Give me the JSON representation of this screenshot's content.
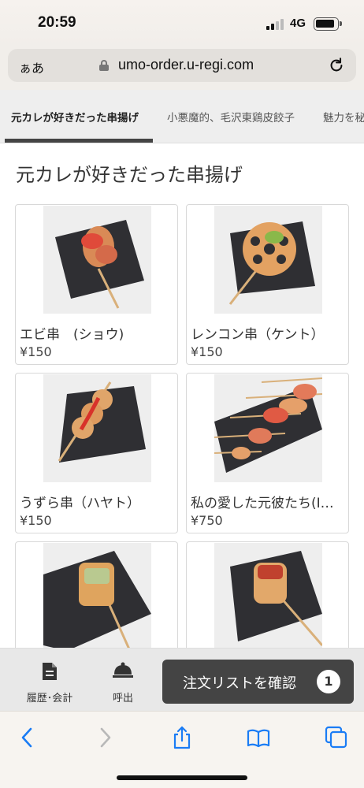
{
  "status": {
    "time": "20:59",
    "network": "4G"
  },
  "browser": {
    "aa_label": "ぁあ",
    "url": "umo-order.u-regi.com"
  },
  "tabs": [
    {
      "label": "元カレが好きだった串揚げ",
      "active": true
    },
    {
      "label": "小悪魔的、毛沢東鶏皮餃子",
      "active": false
    },
    {
      "label": "魅力を秘めた",
      "active": false
    }
  ],
  "section": {
    "title": "元カレが好きだった串揚げ"
  },
  "items": [
    {
      "name": "エビ串　(ショウ)",
      "price": "¥150"
    },
    {
      "name": "レンコン串（ケント）",
      "price": "¥150"
    },
    {
      "name": "うずら串（ハヤト）",
      "price": "¥150"
    },
    {
      "name": "私の愛した元彼たち(I…",
      "price": "¥750"
    },
    {
      "name": "",
      "price": ""
    },
    {
      "name": "",
      "price": ""
    }
  ],
  "app_bar": {
    "history_label": "履歴･会計",
    "call_label": "呼出",
    "order_label": "注文リストを確認",
    "order_count": "1"
  },
  "colors": {
    "accent": "#444444",
    "tab_bg": "#eeeeee",
    "app_bar_bg": "#e8e8e8",
    "ios_blue": "#1a7cf5"
  }
}
